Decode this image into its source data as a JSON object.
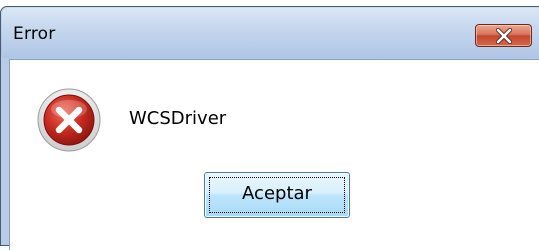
{
  "dialog": {
    "title": "Error",
    "message": "WCSDriver",
    "ok_label": "Aceptar",
    "close_icon": "close-icon",
    "status_icon": "error-icon"
  },
  "colors": {
    "titlebar": "#bcd0ea",
    "close_button": "#c8503a",
    "error_icon": "#c62a1e",
    "ok_button": "#bee6fd"
  }
}
